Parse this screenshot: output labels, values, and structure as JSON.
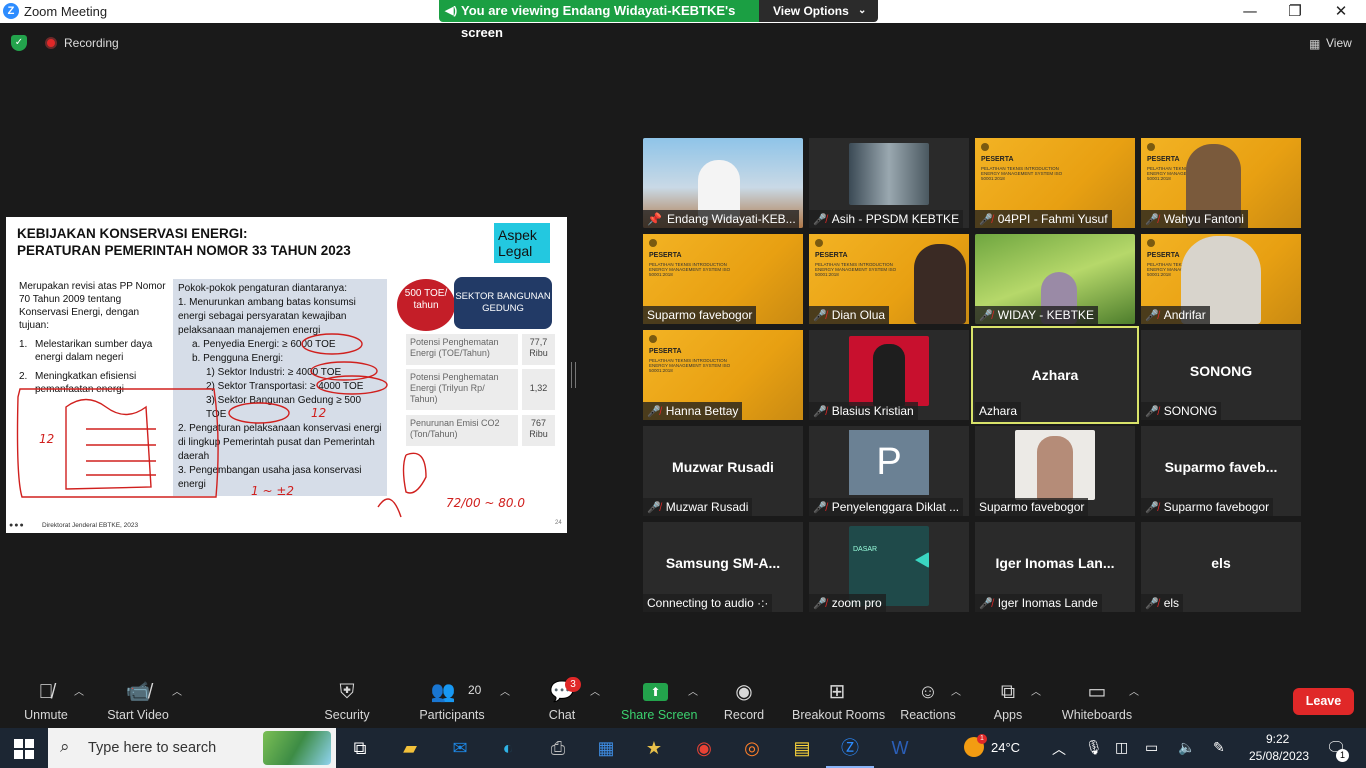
{
  "window": {
    "title": "Zoom Meeting",
    "minimize": "—",
    "maximize": "❐",
    "close": "✕"
  },
  "banner": {
    "text": "You are viewing Endang Widayati-KEBTKE's screen",
    "view_options": "View Options"
  },
  "top_controls": {
    "recording": "Recording",
    "view": "View"
  },
  "slide": {
    "title_line1": "KEBIJAKAN KONSERVASI ENERGI:",
    "title_line2": "PERATURAN PEMERINTAH NOMOR 33 TAHUN 2023",
    "badge": "Aspek Legal",
    "left_intro": "Merupakan revisi atas PP Nomor 70 Tahun 2009 tentang Konservasi Energi, dengan tujuan:",
    "left_items": [
      {
        "num": "1.",
        "text": "Melestarikan sumber daya energi dalam negeri"
      },
      {
        "num": "2.",
        "text": "Meningkatkan efisiensi pemanfaatan energi"
      }
    ],
    "mid": {
      "heading": "Pokok-pokok pengaturan diantaranya:",
      "l1": "1.  Menurunkan ambang batas konsumsi energi sebagai persyaratan kewajiban pelaksanaan manajemen energi",
      "l1a": "a.   Penyedia Energi: ≥ 6000 TOE",
      "l1b": "b.   Pengguna Energi:",
      "l1b1": "1)   Sektor Industri: ≥ 4000 TOE",
      "l1b2": "2)   Sektor Transportasi: ≥ 4000 TOE",
      "l1b3": "3)   Sektor Bangunan Gedung ≥ 500 TOE",
      "l2": "2.  Pengaturan pelaksanaan konservasi energi di lingkup Pemerintah pusat dan Pemerintah daerah",
      "l3": "3.  Pengembangan usaha jasa konservasi energi"
    },
    "circle_badge": "500 TOE/ tahun",
    "sector_badge": "SEKTOR BANGUNAN GEDUNG",
    "stats": [
      {
        "label": "Potensi Penghematan Energi (TOE/Tahun)",
        "value": "77,7 Ribu"
      },
      {
        "label": "Potensi Penghematan Energi (Trilyun Rp/ Tahun)",
        "value": "1,32"
      },
      {
        "label": "Penurunan Emisi CO2 (Ton/Tahun)",
        "value": "767 Ribu"
      }
    ],
    "footer": "Direktorat Jenderal EBTKE, 2023",
    "page": "24",
    "handwriting": {
      "a": "12",
      "b": "12",
      "c": "1/2",
      "d": "1 ~ ±2",
      "e": "72/00 ~ 80.0"
    }
  },
  "poster": {
    "heading": "PESERTA",
    "subtext": "PELATIHAN TEKNIS INTRODUCTION ENERGY MANAGEMENT SYSTEM ISO 50001:2018",
    "date": "25 AGUSTUS 2023",
    "brand": "BNSP"
  },
  "participants": [
    {
      "name": "Endang Widayati-KEB...",
      "pinned": true
    },
    {
      "name": "Asih - PPSDM KEBTKE"
    },
    {
      "name": "04PPI - Fahmi Yusuf"
    },
    {
      "name": "Wahyu Fantoni"
    },
    {
      "name": "Suparmo favebogor"
    },
    {
      "name": "Dian Olua"
    },
    {
      "name": "WIDAY - KEBTKE"
    },
    {
      "name": "Andrifar"
    },
    {
      "name": "Hanna Bettay"
    },
    {
      "name": "Blasius Kristian"
    },
    {
      "name": "Azhara",
      "display": "Azhara"
    },
    {
      "name": "SONONG",
      "display": "SONONG"
    },
    {
      "name": "Muzwar Rusadi",
      "display": "Muzwar Rusadi"
    },
    {
      "name": "Penyelenggara Diklat ...",
      "avatar_letter": "P"
    },
    {
      "name": "Suparmo favebogor"
    },
    {
      "name": "Suparmo favebogor",
      "display": "Suparmo faveb..."
    },
    {
      "name": "Connecting to audio ·:·",
      "display": "Samsung SM-A..."
    },
    {
      "name": "zoom pro",
      "screen_text": "DASAR"
    },
    {
      "name": "Iger Inomas Lande",
      "display": "Iger Inomas Lan..."
    },
    {
      "name": "els",
      "display": "els"
    }
  ],
  "toolbar": {
    "unmute": "Unmute",
    "start_video": "Start Video",
    "security": "Security",
    "participants": "Participants",
    "participants_count": "20",
    "chat": "Chat",
    "chat_badge": "3",
    "share_screen": "Share Screen",
    "record": "Record",
    "breakout": "Breakout Rooms",
    "reactions": "Reactions",
    "apps": "Apps",
    "whiteboards": "Whiteboards",
    "leave": "Leave"
  },
  "taskbar": {
    "search_placeholder": "Type here to search",
    "weather_temp": "24°C",
    "weather_badge": "1",
    "time": "9:22",
    "date": "25/08/2023",
    "notif_count": "1"
  },
  "colors": {
    "accent_green": "#23a34c",
    "leave_red": "#e02828",
    "active_speaker": "#d9e36a",
    "zoom_blue": "#2d8cff"
  }
}
